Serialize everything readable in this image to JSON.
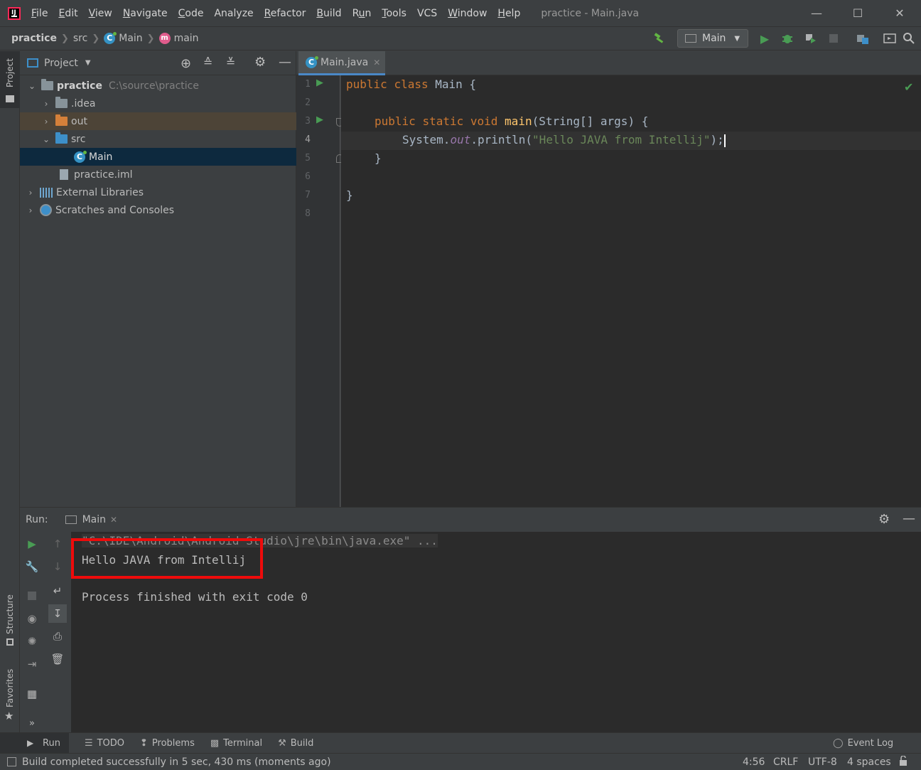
{
  "menubar": {
    "items": [
      "File",
      "Edit",
      "View",
      "Navigate",
      "Code",
      "Analyze",
      "Refactor",
      "Build",
      "Run",
      "Tools",
      "VCS",
      "Window",
      "Help"
    ],
    "underline": [
      "F",
      "E",
      "V",
      "N",
      "C",
      "",
      "R",
      "B",
      "u",
      "T",
      "",
      "W",
      "H"
    ],
    "window_title": "practice - Main.java"
  },
  "navbar": {
    "crumbs": [
      "practice",
      "src",
      "Main",
      "main"
    ],
    "run_config": "Main"
  },
  "left_strip": {
    "project_label": "Project",
    "structure_label": "Structure",
    "favorites_label": "Favorites"
  },
  "project": {
    "header_label": "Project",
    "tree": [
      {
        "label": "practice",
        "path": "C:\\source\\practice",
        "depth": 0,
        "expanded": true
      },
      {
        "label": ".idea",
        "depth": 1,
        "expanded": false
      },
      {
        "label": "out",
        "depth": 1,
        "expanded": false
      },
      {
        "label": "src",
        "depth": 1,
        "expanded": true
      },
      {
        "label": "Main",
        "depth": 2
      },
      {
        "label": "practice.iml",
        "depth": 1
      },
      {
        "label": "External Libraries",
        "depth": 0,
        "expanded": false
      },
      {
        "label": "Scratches and Consoles",
        "depth": 0,
        "expanded": false
      }
    ]
  },
  "editor": {
    "tab_label": "Main.java",
    "line_numbers": [
      "1",
      "2",
      "3",
      "4",
      "5",
      "6",
      "7",
      "8"
    ],
    "code": {
      "l1_kw1": "public",
      "l1_kw2": "class",
      "l1_rest": "Main {",
      "l3_kw1": "public",
      "l3_kw2": "static",
      "l3_kw3": "void",
      "l3_fn": "main",
      "l3_rest": "(String[] args) {",
      "l4_pre": "System.",
      "l4_field": "out",
      "l4_call": ".println(",
      "l4_str": "\"Hello JAVA from Intellij\"",
      "l4_end": ");",
      "l5": "}",
      "l7": "}"
    }
  },
  "run_panel": {
    "label": "Run:",
    "tab_label": "Main",
    "console_lines": [
      "\"C:\\IDE\\Android\\Android Studio\\jre\\bin\\java.exe\" ...",
      "Hello JAVA from Intellij",
      "",
      "Process finished with exit code 0"
    ]
  },
  "bottom_tabs": {
    "run": "Run",
    "todo": "TODO",
    "problems": "Problems",
    "terminal": "Terminal",
    "build": "Build",
    "event_log": "Event Log"
  },
  "status": {
    "message": "Build completed successfully in 5 sec, 430 ms (moments ago)",
    "position": "4:56",
    "line_sep": "CRLF",
    "encoding": "UTF-8",
    "indent": "4 spaces"
  },
  "colors": {
    "accent": "#4a88c7",
    "run_green": "#499c54",
    "highlight_red": "#ee0b0b"
  }
}
